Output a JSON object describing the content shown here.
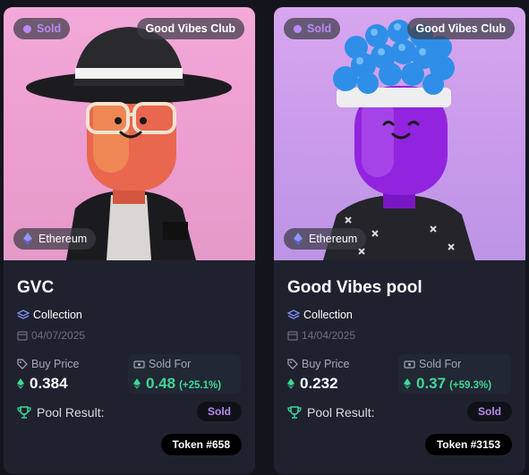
{
  "cards": [
    {
      "status": "Sold",
      "collection": "Good Vibes Club",
      "chain": "Ethereum",
      "title": "GVC",
      "type": "Collection",
      "date": "04/07/2025",
      "buy_label": "Buy Price",
      "buy_price": "0.384",
      "sold_label": "Sold For",
      "sold_price": "0.48",
      "change": "(+25.1%)",
      "pool_label": "Pool Result:",
      "pool_result": "Sold",
      "token": "Token #658",
      "art_colors": {
        "bg": "#ec9ccf",
        "body": "#e9664f"
      }
    },
    {
      "status": "Sold",
      "collection": "Good Vibes Club",
      "chain": "Ethereum",
      "title": "Good Vibes pool",
      "type": "Collection",
      "date": "14/04/2025",
      "buy_label": "Buy Price",
      "buy_price": "0.232",
      "sold_label": "Sold For",
      "sold_price": "0.37",
      "change": "(+59.3%)",
      "pool_label": "Pool Result:",
      "pool_result": "Sold",
      "token": "Token #3153",
      "art_colors": {
        "bg": "#c799ea",
        "body": "#9224e0"
      }
    }
  ],
  "colors": {
    "accent_purple": "#b98af5",
    "positive_green": "#3ed897",
    "card_bg": "#1f222e"
  }
}
